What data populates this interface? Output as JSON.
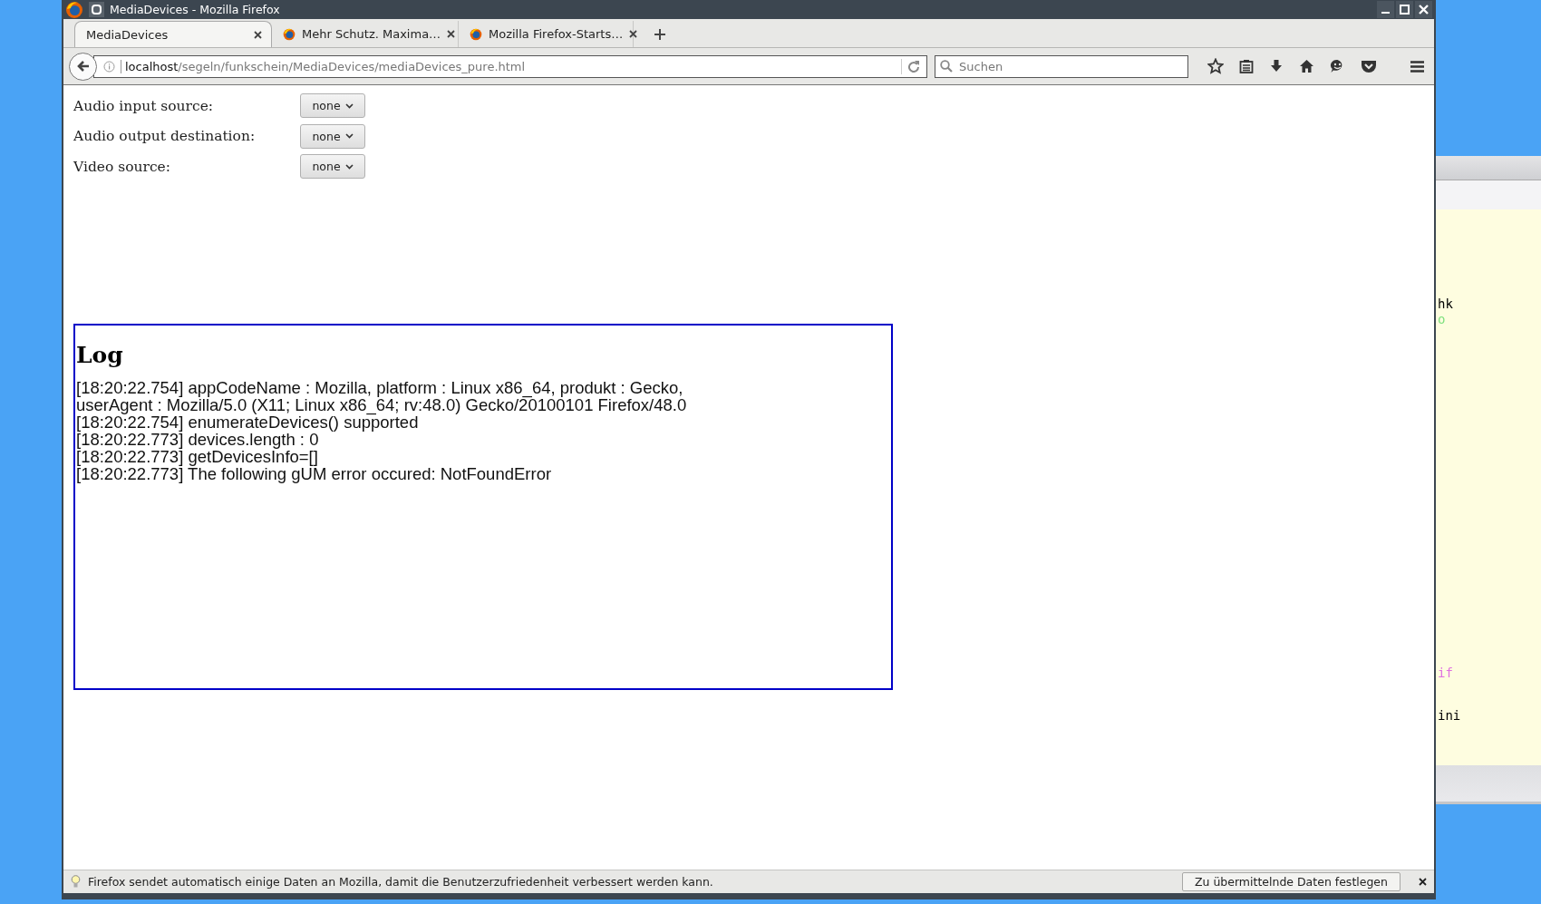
{
  "window": {
    "title": "MediaDevices - Mozilla Firefox"
  },
  "tabs": [
    {
      "label": "MediaDevices",
      "selected": true,
      "favicon": false
    },
    {
      "label": "Mehr Schutz. Maxima…",
      "selected": false,
      "favicon": true
    },
    {
      "label": "Mozilla Firefox-Starts…",
      "selected": false,
      "favicon": true
    }
  ],
  "address_bar": {
    "host": "localhost",
    "path": "/segeln/funkschein/MediaDevices/mediaDevices_pure.html"
  },
  "search": {
    "placeholder": "Suchen"
  },
  "form": {
    "fields": [
      {
        "label": "Audio input source:",
        "value": "none"
      },
      {
        "label": "Audio output destination:",
        "value": "none"
      },
      {
        "label": "Video source:",
        "value": "none"
      }
    ]
  },
  "log": {
    "heading": "Log",
    "lines": [
      "[18:20:22.754] appCodeName : Mozilla, platform : Linux x86_64, produkt : Gecko,",
      "userAgent : Mozilla/5.0 (X11; Linux x86_64; rv:48.0) Gecko/20100101 Firefox/48.0",
      "[18:20:22.754] enumerateDevices() supported",
      "[18:20:22.773] devices.length : 0",
      "[18:20:22.773] getDevicesInfo=[]",
      "[18:20:22.773] The following gUM error occured: NotFoundError"
    ]
  },
  "notification": {
    "message": "Firefox sendet automatisch einige Daten an Mozilla, damit die Benutzerzufriedenheit verbessert werden kann.",
    "button": "Zu übermittelnde Daten festlegen"
  },
  "background_window": {
    "code_fragments": [
      {
        "text": "hk",
        "color": "#000000"
      },
      {
        "text": "o",
        "color": "#7ee07e"
      },
      {
        "text": "if",
        "color": "#e070e0"
      },
      {
        "text": "ini",
        "color": "#000000"
      }
    ]
  }
}
